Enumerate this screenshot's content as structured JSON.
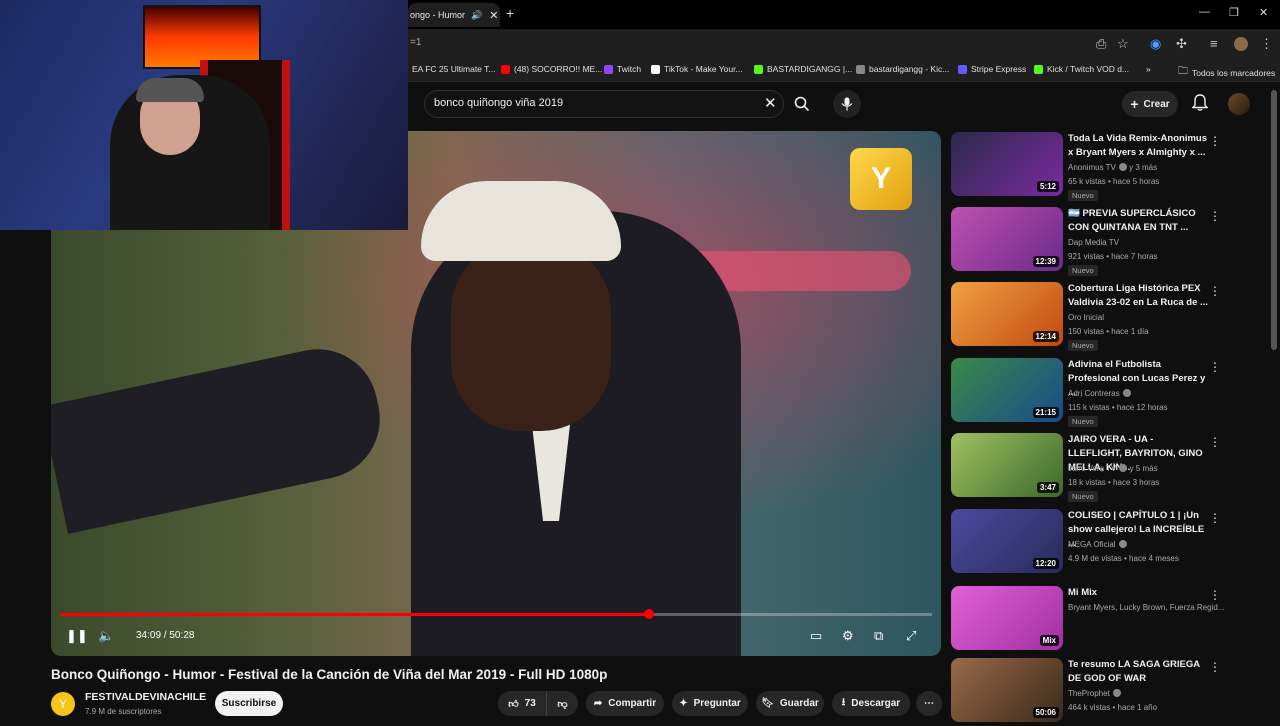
{
  "browser": {
    "tab_title": "ongo - Humor",
    "url_fragment": "=1",
    "bookmarks": [
      {
        "label": "EA FC 25 Ultimate T...",
        "color": "#ff3b30"
      },
      {
        "label": "(48) SOCORRO!! ME...",
        "color": "#ff0000"
      },
      {
        "label": "Twitch",
        "color": "#9146ff"
      },
      {
        "label": "TikTok - Make Your...",
        "color": "#ffffff"
      },
      {
        "label": "BASTARDIGANGG |...",
        "color": "#53fc18"
      },
      {
        "label": "bastardigangg - Kic...",
        "color": "#888888"
      },
      {
        "label": "Stripe Express",
        "color": "#635bff"
      },
      {
        "label": "Kick / Twitch VOD d...",
        "color": "#53fc18"
      }
    ],
    "all_bookmarks": "Todos los marcadores"
  },
  "header": {
    "search_query": "bonco quiñongo viña 2019",
    "create_label": "Crear"
  },
  "player": {
    "time_current": "34:09",
    "time_total": "50:28",
    "time_display": "34:09 / 50:28",
    "progress_fraction": 0.676
  },
  "video": {
    "title": "Bonco Quiñongo - Humor - Festival de la Canción de Viña del Mar 2019 - Full HD 1080p",
    "channel": "FESTIVALDEVINACHILE",
    "subscribers": "7.9 M de suscriptores",
    "subscribe_label": "Suscribirse",
    "likes": "73",
    "share_label": "Compartir",
    "ask_label": "Preguntar",
    "save_label": "Guardar",
    "download_label": "Descargar"
  },
  "recommendations": [
    {
      "title": "Toda La Vida Remix-Anonimus x Bryant Myers x Almighty x ...",
      "channel": "Anonimus TV",
      "channel_suffix": "y 3 más",
      "meta": "65 k vistas • hace 5 horas",
      "badge": "Nuevo",
      "duration": "5:12",
      "thumb": "#4a2a6a"
    },
    {
      "title": "🇦🇷 PREVIA SUPERCLÁSICO CON QUINTANA EN TNT ...",
      "channel": "Dap Media TV",
      "channel_suffix": "",
      "meta": "921 vistas • hace 7 horas",
      "badge": "Nuevo",
      "duration": "12:39",
      "thumb": "#b04aa0"
    },
    {
      "title": "Cobertura Liga Histórica PEX Valdivia 23-02 en La Ruca de ...",
      "channel": "Oro Inicial",
      "channel_suffix": "",
      "meta": "150 vistas • hace 1 día",
      "badge": "Nuevo",
      "duration": "12:14",
      "thumb": "#d8782a"
    },
    {
      "title": "Adivina el Futbolista Profesional con Lucas Perez y ...",
      "channel": "Adri Contreras",
      "channel_suffix": "",
      "meta": "115 k vistas • hace 12 horas",
      "badge": "Nuevo",
      "duration": "21:15",
      "thumb": "#2a6a3a"
    },
    {
      "title": "JAIRO VERA - UA - LLEFLIGHT, BAYRITON, GINO MELLA, KIN...",
      "channel": "Jairo Vera TV",
      "channel_suffix": "y 5 más",
      "meta": "18 k vistas • hace 3 horas",
      "badge": "Nuevo",
      "duration": "3:47",
      "thumb": "#6a8a3a"
    },
    {
      "title": "COLISEO | CAPÍTULO 1 | ¡Un show callejero! La INCREÍBLE ...",
      "channel": "MEGA Oficial",
      "channel_suffix": "",
      "meta": "4.9 M de vistas • hace 4 meses",
      "badge": "",
      "duration": "12:20",
      "thumb": "#3a3a8a"
    },
    {
      "title": "Mi Mix",
      "channel": "Bryant Myers, Lucky Brown, Fuerza Regid...",
      "channel_suffix": "",
      "meta": "",
      "badge": "",
      "duration": "Mix",
      "thumb": "#d050c8"
    },
    {
      "title": "Te resumo LA SAGA GRIEGA DE GOD OF WAR",
      "channel": "TheProphet",
      "channel_suffix": "",
      "meta": "464 k vistas • hace 1 año",
      "badge": "",
      "duration": "50:06",
      "thumb": "#7a5a3a"
    }
  ]
}
